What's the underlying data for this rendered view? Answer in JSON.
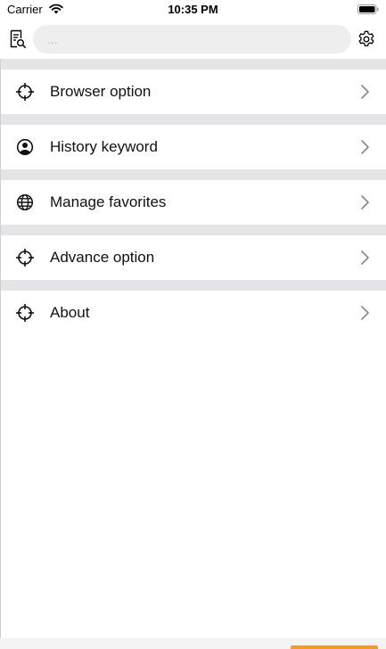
{
  "status_bar": {
    "carrier": "Carrier",
    "time": "10:35 PM",
    "wifi_icon": "wifi-icon",
    "battery_icon": "battery-full-icon"
  },
  "nav_bar": {
    "left_icon": "document-search-icon",
    "search_placeholder": "...",
    "search_value": "",
    "right_icon": "gear-icon"
  },
  "menu": {
    "items": [
      {
        "label": "Browser option",
        "icon": "crosshair-icon"
      },
      {
        "label": "History keyword",
        "icon": "user-circle-icon"
      },
      {
        "label": "Manage favorites",
        "icon": "globe-icon"
      },
      {
        "label": "Advance option",
        "icon": "crosshair-icon"
      },
      {
        "label": "About",
        "icon": "crosshair-icon"
      }
    ],
    "chevron_icon": "chevron-right-icon"
  },
  "colors": {
    "separator": "#e5e5e7",
    "search_background": "#eeeeef",
    "home_indicator_accent": "#f29b2a"
  }
}
